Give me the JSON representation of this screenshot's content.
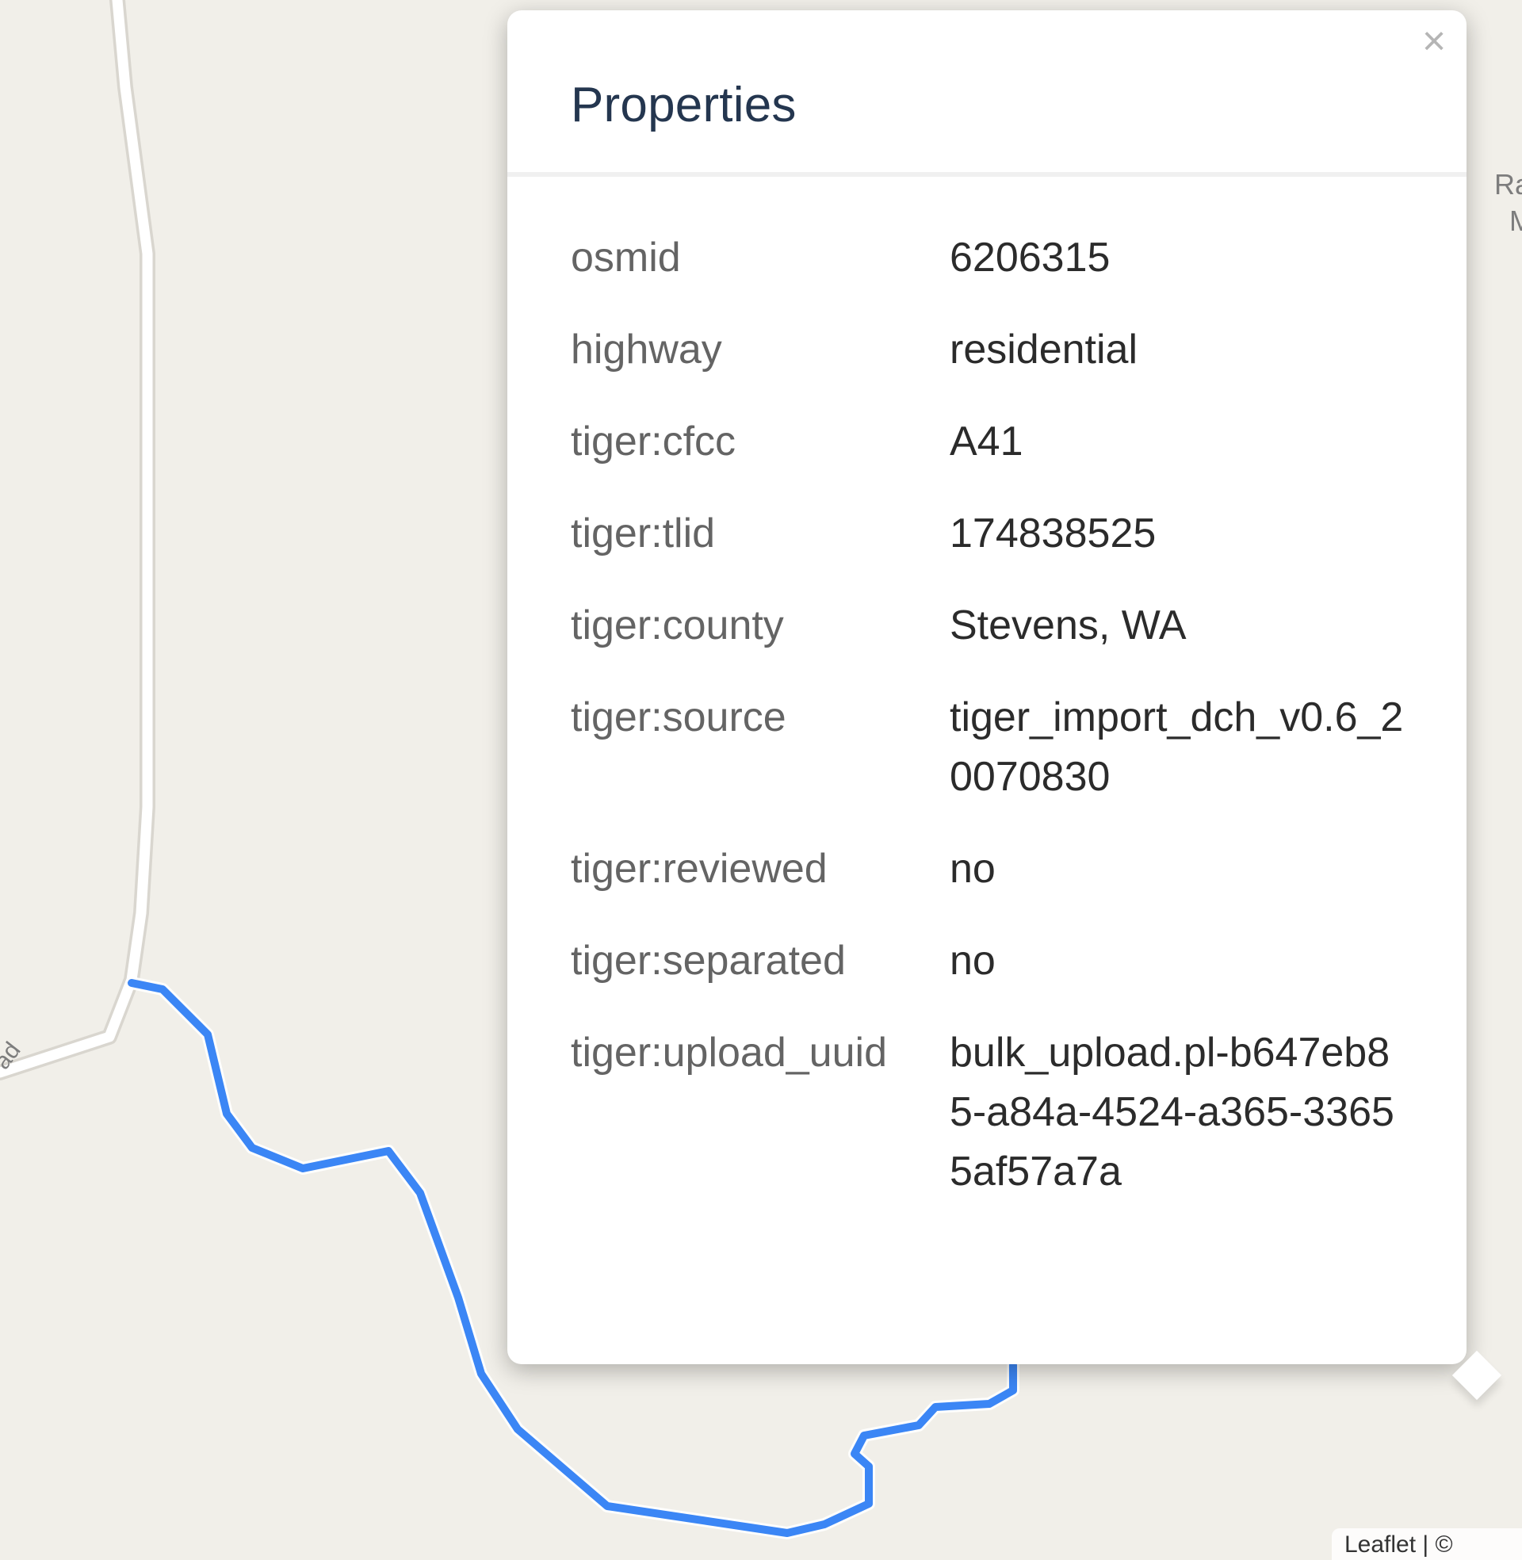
{
  "map": {
    "road_label": "ad",
    "edge_labels": [
      "Ra",
      "M"
    ],
    "attribution": "Leaflet | ©"
  },
  "popup": {
    "title": "Properties",
    "close_symbol": "×",
    "properties": [
      {
        "key": "osmid",
        "value": "6206315"
      },
      {
        "key": "highway",
        "value": "residential"
      },
      {
        "key": "tiger:cfcc",
        "value": "A41"
      },
      {
        "key": "tiger:tlid",
        "value": "174838525"
      },
      {
        "key": "tiger:county",
        "value": "Stevens, WA"
      },
      {
        "key": "tiger:source",
        "value": "tiger_import_dch_v0.6_20070830"
      },
      {
        "key": "tiger:reviewed",
        "value": "no"
      },
      {
        "key": "tiger:separated",
        "value": "no"
      },
      {
        "key": "tiger:upload_uuid",
        "value": "bulk_upload.pl-b647eb85-a84a-4524-a365-33655af57a7a"
      }
    ]
  },
  "colors": {
    "map_background": "#f1efe9",
    "road": "#ffffff",
    "highlight_route": "#3b86f5",
    "title": "#24364f"
  }
}
